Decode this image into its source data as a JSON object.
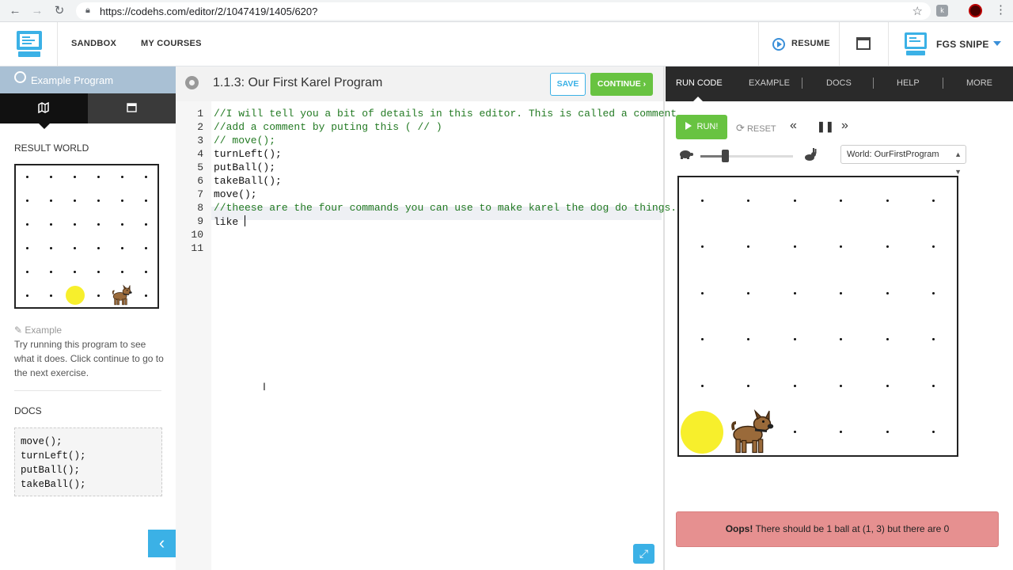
{
  "browser": {
    "url": "https://codehs.com/editor/2/1047419/1405/620?"
  },
  "header": {
    "sandbox": "SANDBOX",
    "my_courses": "MY COURSES",
    "resume": "RESUME",
    "user_name": "FGS SNIPE"
  },
  "sidebar": {
    "program_label": "Example Program",
    "result_world_heading": "RESULT WORLD",
    "example_heading": "Example",
    "example_text": "Try running this program to see what it does. Click continue to go to the next exercise.",
    "docs_heading": "DOCS",
    "docs_commands": [
      "move();",
      "turnLeft();",
      "putBall();",
      "takeBall();"
    ]
  },
  "editor": {
    "title": "1.1.3: Our First Karel Program",
    "save_label": "SAVE",
    "continue_label": "CONTINUE ›",
    "lines": [
      {
        "n": "1",
        "text": "//I will tell you a bit of details in this editor. This is called a comment",
        "kind": "comment"
      },
      {
        "n": "2",
        "text": "//add a comment by puting this ( // )",
        "kind": "comment"
      },
      {
        "n": "3",
        "text": "// move();",
        "kind": "comment"
      },
      {
        "n": "4",
        "text": "turnLeft();",
        "kind": "plain"
      },
      {
        "n": "5",
        "text": "putBall();",
        "kind": "plain"
      },
      {
        "n": "6",
        "text": "takeBall();",
        "kind": "plain"
      },
      {
        "n": "7",
        "text": "move();",
        "kind": "plain"
      },
      {
        "n": "8",
        "text": "//theese are the four commands you can use to make karel the dog do things.",
        "kind": "comment"
      },
      {
        "n": "9",
        "text": "like ",
        "kind": "plain"
      },
      {
        "n": "10",
        "text": "",
        "kind": "plain"
      },
      {
        "n": "11",
        "text": "",
        "kind": "plain"
      }
    ]
  },
  "right_panel": {
    "tabs": [
      "RUN CODE",
      "EXAMPLE",
      "DOCS",
      "HELP",
      "MORE"
    ],
    "run_label": "RUN!",
    "reset_label": "RESET",
    "world_select": "World: OurFirstProgram",
    "speed_fraction": 0.25,
    "error_bold": "Oops!",
    "error_text": " There should be 1 ball at (1, 3) but there are 0"
  },
  "colors": {
    "accent_blue": "#3bb1e6",
    "run_green": "#68c341",
    "comment_green": "#237a23",
    "error_red": "#e69090",
    "ball_yellow": "#f7ef2c"
  }
}
